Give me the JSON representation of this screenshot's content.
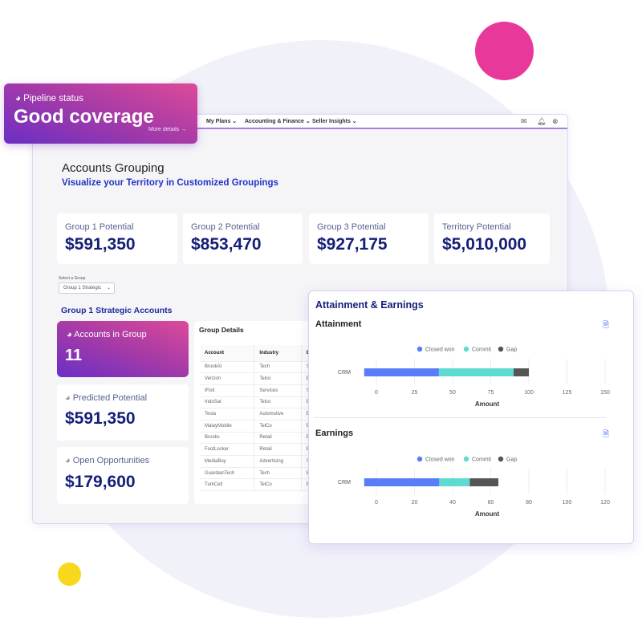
{
  "nav": {
    "items": [
      "My Plans",
      "Accounting & Finance",
      "Seller Insights"
    ],
    "icons": [
      "mail-icon",
      "bell-icon",
      "user-icon"
    ]
  },
  "pipeline": {
    "label": "Pipeline status",
    "value": "Good coverage",
    "link": "More details →"
  },
  "page": {
    "title": "Accounts Grouping",
    "subtitle": "Visualize your Territory in Customized Groupings"
  },
  "stats": [
    {
      "label": "Group 1 Potential",
      "value": "$591,350"
    },
    {
      "label": "Group 2 Potential",
      "value": "$853,470"
    },
    {
      "label": "Group 3 Potential",
      "value": "$927,175"
    },
    {
      "label": "Territory Potential",
      "value": "$5,010,000"
    }
  ],
  "select": {
    "label": "Select a Group",
    "value": "Group 1 Strategic"
  },
  "group": {
    "heading": "Group 1 Strategic Accounts",
    "accounts": {
      "label": "Accounts in Group",
      "value": "11"
    },
    "predicted": {
      "label": "Predicted Potential",
      "value": "$591,350"
    },
    "opportunities": {
      "label": "Open Opportunities",
      "value": "$179,600"
    }
  },
  "details": {
    "title": "Group Details",
    "columns": [
      "Account",
      "Industry",
      "Bus"
    ],
    "rows": [
      [
        "BrookAI",
        "Tech",
        "SM"
      ],
      [
        "Verizon",
        "Telco",
        "Ent"
      ],
      [
        "iFixit",
        "Services",
        "SM"
      ],
      [
        "IndoSat",
        "Telco",
        "Ent"
      ],
      [
        "Tesla",
        "Automotive",
        "Ent"
      ],
      [
        "MalayMobile",
        "TelCo",
        "Ent"
      ],
      [
        "Brooks",
        "Retail",
        "Ent"
      ],
      [
        "FootLocker",
        "Retail",
        "Ent"
      ],
      [
        "MediaBuy",
        "Advertising",
        "SM"
      ],
      [
        "GuardianTech",
        "Tech",
        "Ent"
      ],
      [
        "TurkCell",
        "TelCo",
        "Ent"
      ]
    ]
  },
  "panel": {
    "title": "Attainment & Earnings"
  },
  "chart_data": [
    {
      "type": "bar",
      "orientation": "horizontal",
      "stacked": true,
      "title": "Attainment",
      "categories": [
        "CRM"
      ],
      "series": [
        {
          "name": "Closed won",
          "values": [
            41
          ],
          "color": "#5a7cf7"
        },
        {
          "name": "Commit",
          "values": [
            49
          ],
          "color": "#5ddbd0"
        },
        {
          "name": "Gap",
          "values": [
            10
          ],
          "color": "#555555"
        }
      ],
      "xlabel": "Amount",
      "xlim": [
        0,
        150
      ],
      "xticks": [
        0,
        25,
        50,
        75,
        100,
        125,
        150
      ],
      "grid": true,
      "legend": "top"
    },
    {
      "type": "bar",
      "orientation": "horizontal",
      "stacked": true,
      "title": "Earnings",
      "categories": [
        "CRM"
      ],
      "series": [
        {
          "name": "Closed won",
          "values": [
            33
          ],
          "color": "#5a7cf7"
        },
        {
          "name": "Commit",
          "values": [
            16
          ],
          "color": "#5ddbd0"
        },
        {
          "name": "Gap",
          "values": [
            15
          ],
          "color": "#555555"
        }
      ],
      "xlabel": "Amount",
      "xlim": [
        0,
        120
      ],
      "xticks": [
        0,
        20,
        40,
        60,
        80,
        100,
        120
      ],
      "grid": true,
      "legend": "top"
    }
  ]
}
